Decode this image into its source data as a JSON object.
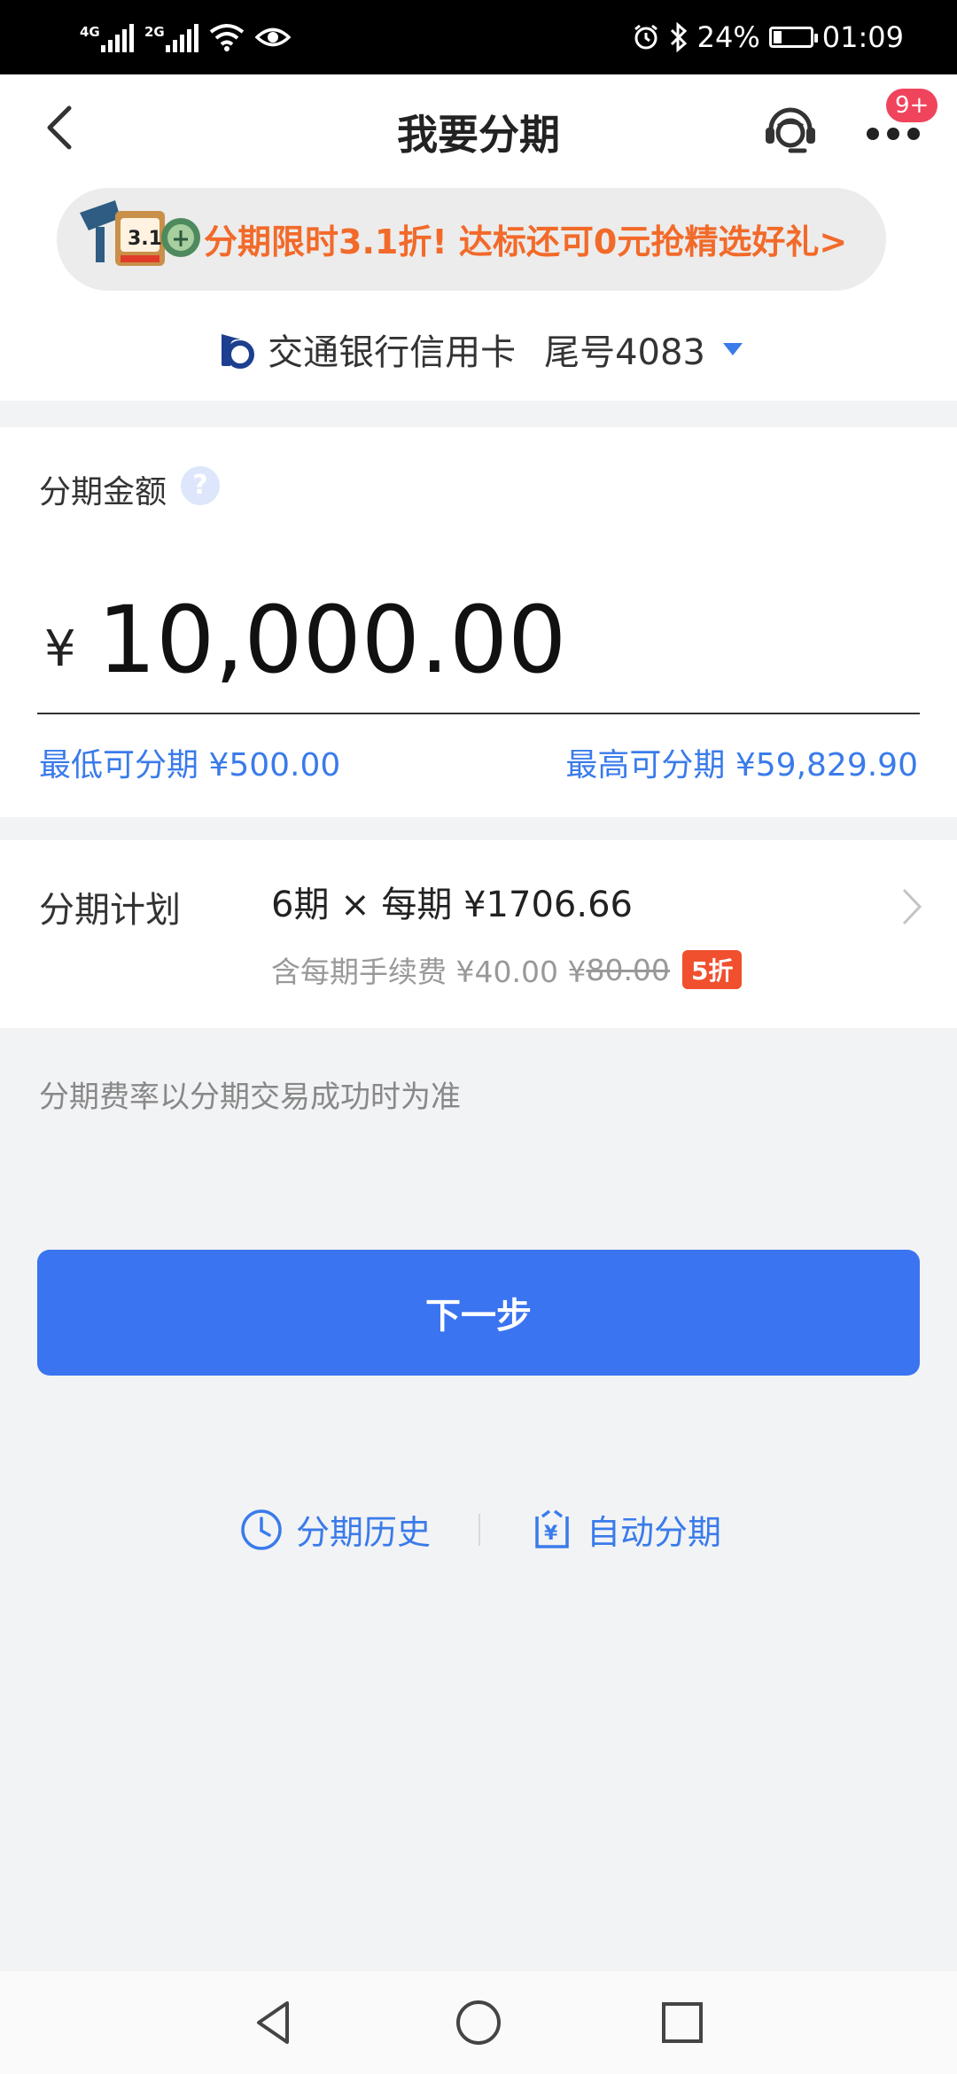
{
  "status_bar": {
    "net1": "4G",
    "net2": "2G",
    "battery": "24%",
    "battery_level": 0.24,
    "time": "01:09"
  },
  "header": {
    "title": "我要分期",
    "badge": "9+"
  },
  "promo": {
    "text": "分期限时3.1折! 达标还可0元抢精选好礼>",
    "image_label": "3.1"
  },
  "card": {
    "name": "交通银行信用卡",
    "tail": "尾号4083"
  },
  "amount": {
    "label": "分期金额",
    "help": "?",
    "currency": "¥",
    "value": "10,000.00",
    "min": "最低可分期 ¥500.00",
    "max": "最高可分期 ¥59,829.90"
  },
  "plan": {
    "label": "分期计划",
    "main": "6期 × 每期 ¥1706.66",
    "fee_prefix": "含每期手续费 ¥40.00 ¥",
    "fee_original": "80.00",
    "discount": "5折"
  },
  "note": "分期费率以分期交易成功时为准",
  "next_button": "下一步",
  "links": {
    "history": "分期历史",
    "auto": "自动分期"
  },
  "colors": {
    "accent": "#3b74f0",
    "link": "#3a7bea",
    "promo": "#f26a2a",
    "discount": "#f0502e",
    "badge": "#f0445c"
  }
}
